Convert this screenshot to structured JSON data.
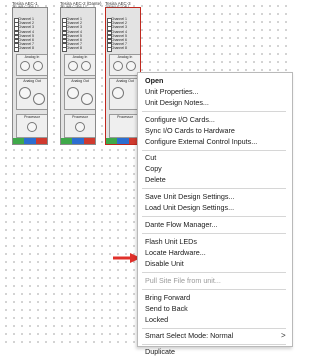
{
  "units": [
    {
      "title": "Tesira AEC-1",
      "subtitle": "TP-IN5 C1D8-1",
      "channels": [
        "Channel 1",
        "Channel 2",
        "Channel 3",
        "Channel 4",
        "Channel 5",
        "Channel 6",
        "Channel 7",
        "Channel 8"
      ],
      "section_in": "Analog In",
      "section_out": "Analog Out",
      "section_proc": "Processor",
      "selected": false
    },
    {
      "title": "Tesira AEC-2 (Dante)",
      "subtitle": "TP-IN5 C1D8-1",
      "channels": [
        "Channel 1",
        "Channel 2",
        "Channel 3",
        "Channel 4",
        "Channel 5",
        "Channel 6",
        "Channel 7",
        "Channel 8"
      ],
      "section_in": "Analog In",
      "section_out": "Analog Out",
      "section_proc": "Processor",
      "selected": false
    },
    {
      "title": "Tesira AEC-3",
      "subtitle": "TP-IN5 C1D8-1",
      "channels": [
        "Channel 1",
        "Channel 2",
        "Channel 3",
        "Channel 4",
        "Channel 5",
        "Channel 6",
        "Channel 7",
        "Channel 8"
      ],
      "section_in": "Analog In",
      "section_out": "Analog Out",
      "section_proc": "Processor",
      "selected": true
    }
  ],
  "context_menu": {
    "items": [
      {
        "label": "Open",
        "enabled": true
      },
      {
        "label": "Unit Properties...",
        "enabled": true
      },
      {
        "label": "Unit Design Notes...",
        "enabled": true
      },
      {
        "label": "Configure I/O Cards...",
        "enabled": true
      },
      {
        "label": "Sync I/O Cards to Hardware",
        "enabled": true
      },
      {
        "label": "Configure External Control Inputs...",
        "enabled": true
      },
      {
        "label": "Cut",
        "enabled": true
      },
      {
        "label": "Copy",
        "enabled": true
      },
      {
        "label": "Delete",
        "enabled": true
      },
      {
        "label": "Save Unit Design Settings...",
        "enabled": true
      },
      {
        "label": "Load Unit Design Settings...",
        "enabled": true
      },
      {
        "label": "Dante Flow Manager...",
        "enabled": true
      },
      {
        "label": "Flash Unit LEDs",
        "enabled": true
      },
      {
        "label": "Locate Hardware...",
        "enabled": true
      },
      {
        "label": "Disable Unit",
        "enabled": true
      },
      {
        "label": "Pull Site File from unit...",
        "enabled": false
      },
      {
        "label": "Bring Forward",
        "enabled": true
      },
      {
        "label": "Send to Back",
        "enabled": true
      },
      {
        "label": "Locked",
        "enabled": true
      },
      {
        "label": "Smart Select Mode: Normal",
        "enabled": true,
        "submenu_glyph": ">"
      },
      {
        "label": "Duplicate",
        "enabled": true
      }
    ]
  },
  "icons": {
    "pointer_arrow": "red-right-arrow-icon",
    "submenu_arrow": "chevron-right-icon"
  },
  "colors": {
    "selection_border": "#c0281e",
    "pointer_arrow": "#e0302a",
    "disabled_text": "#9a9a9a"
  }
}
